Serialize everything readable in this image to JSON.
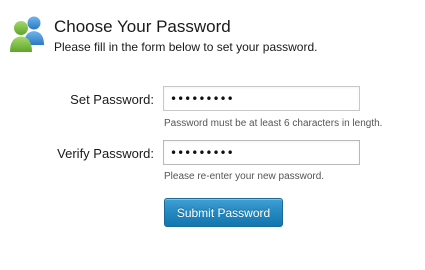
{
  "header": {
    "icon": "users-icon",
    "title": "Choose Your Password",
    "subtitle": "Please fill in the form below to set your password."
  },
  "form": {
    "set_password": {
      "label": "Set Password:",
      "value": "•••••••••",
      "hint": "Password must be at least 6 characters in length."
    },
    "verify_password": {
      "label": "Verify Password:",
      "value": "•••••••••",
      "hint": "Please re-enter your new password."
    },
    "submit_label": "Submit Password"
  },
  "colors": {
    "button_blue": "#2388c1",
    "icon_green": "#7cc242",
    "icon_blue": "#3a8fd6"
  }
}
